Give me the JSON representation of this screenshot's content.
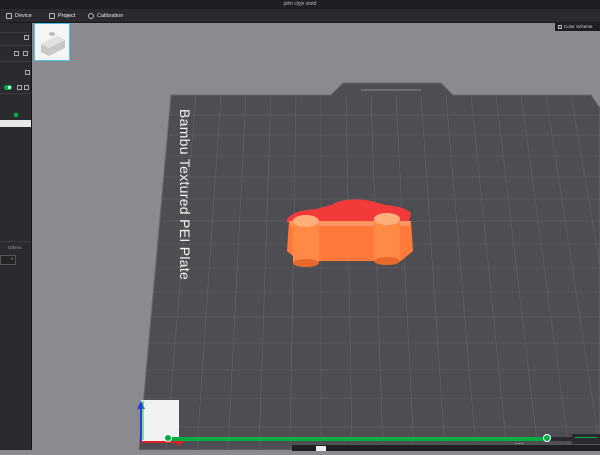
{
  "window": {
    "title": "john clyjn slotd"
  },
  "tabs": [
    {
      "label": "Device",
      "icon": "monitor-icon"
    },
    {
      "label": "Project",
      "icon": "cube-icon"
    },
    {
      "label": "Calibration",
      "icon": "calibration-icon"
    }
  ],
  "toolbar": {
    "color_scheme_label": "Color Scheme"
  },
  "sidebar": {
    "others_label": "Others",
    "input_value": "5"
  },
  "plate": {
    "label": "Bambu Textured PEI Plate"
  },
  "colors": {
    "accent": "#00ae42",
    "model": "#ff7a3a",
    "model_top": "#f23a3a",
    "plate": "#4e4e52",
    "grid": "#65656a"
  },
  "bottom_bar": {
    "layer_readout": "1153"
  }
}
